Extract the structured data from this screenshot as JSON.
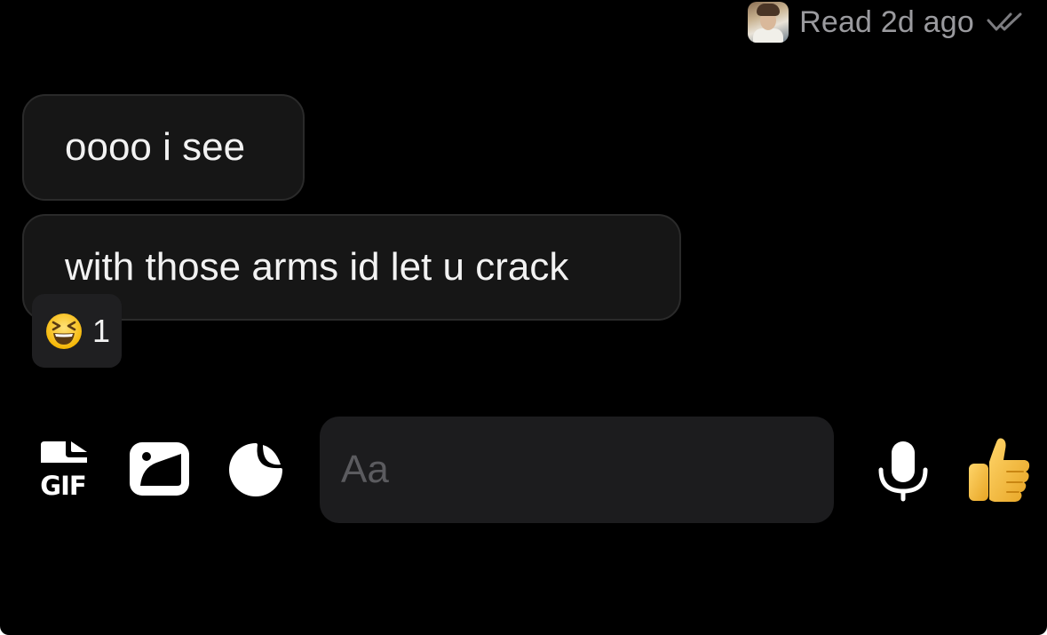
{
  "receipt": {
    "text": "Read 2d ago",
    "avatar_icon": "user-avatar",
    "status_icon": "double-check-icon"
  },
  "messages": [
    {
      "text": "oooo i see"
    },
    {
      "text": "with those arms id let u crack"
    }
  ],
  "reaction": {
    "emoji_icon": "grinning-squinting-face",
    "count": "1"
  },
  "composer": {
    "placeholder": "Aa",
    "tools": [
      "gif-icon",
      "image-icon",
      "sticker-icon"
    ],
    "mic_icon": "mic-icon",
    "send_icon": "thumbs-up-icon"
  },
  "colors": {
    "background": "#000000",
    "bubble": "#161616",
    "composer": "#1c1c1e",
    "muted_text": "#9a9a9e"
  }
}
